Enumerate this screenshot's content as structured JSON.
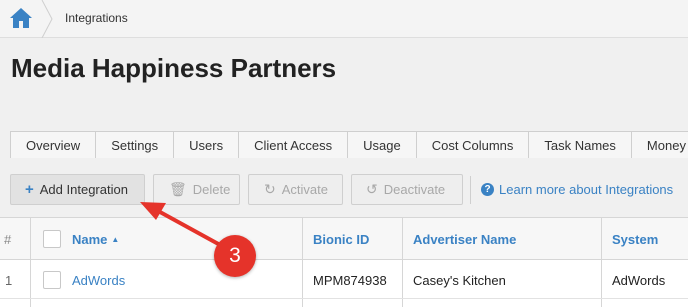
{
  "breadcrumb": {
    "home_icon": "home-icon",
    "current": "Integrations"
  },
  "page": {
    "title": "Media Happiness Partners"
  },
  "tabs": [
    {
      "label": "Overview"
    },
    {
      "label": "Settings"
    },
    {
      "label": "Users"
    },
    {
      "label": "Client Access"
    },
    {
      "label": "Usage"
    },
    {
      "label": "Cost Columns"
    },
    {
      "label": "Task Names"
    },
    {
      "label": "Money C"
    }
  ],
  "toolbar": {
    "add_label": "Add Integration",
    "add_icon": "+",
    "delete_label": "Delete",
    "delete_icon": "🗑",
    "activate_label": "Activate",
    "activate_icon": "↻",
    "deactivate_label": "Deactivate",
    "deactivate_icon": "↺",
    "learn_more_label": "Learn more about Integrations",
    "help_icon": "?"
  },
  "grid": {
    "columns": {
      "index": "#",
      "name": "Name",
      "bionic_id": "Bionic ID",
      "advertiser_name": "Advertiser Name",
      "system": "System"
    },
    "rows": [
      {
        "index": "1",
        "name": "AdWords",
        "bionic_id": "MPM874938",
        "advertiser_name": "Casey's Kitchen",
        "system": "AdWords"
      }
    ]
  },
  "annotation": {
    "step_number": "3"
  },
  "colors": {
    "accent": "#3a82c4",
    "annotation": "#e5332a",
    "title": "#222222"
  }
}
